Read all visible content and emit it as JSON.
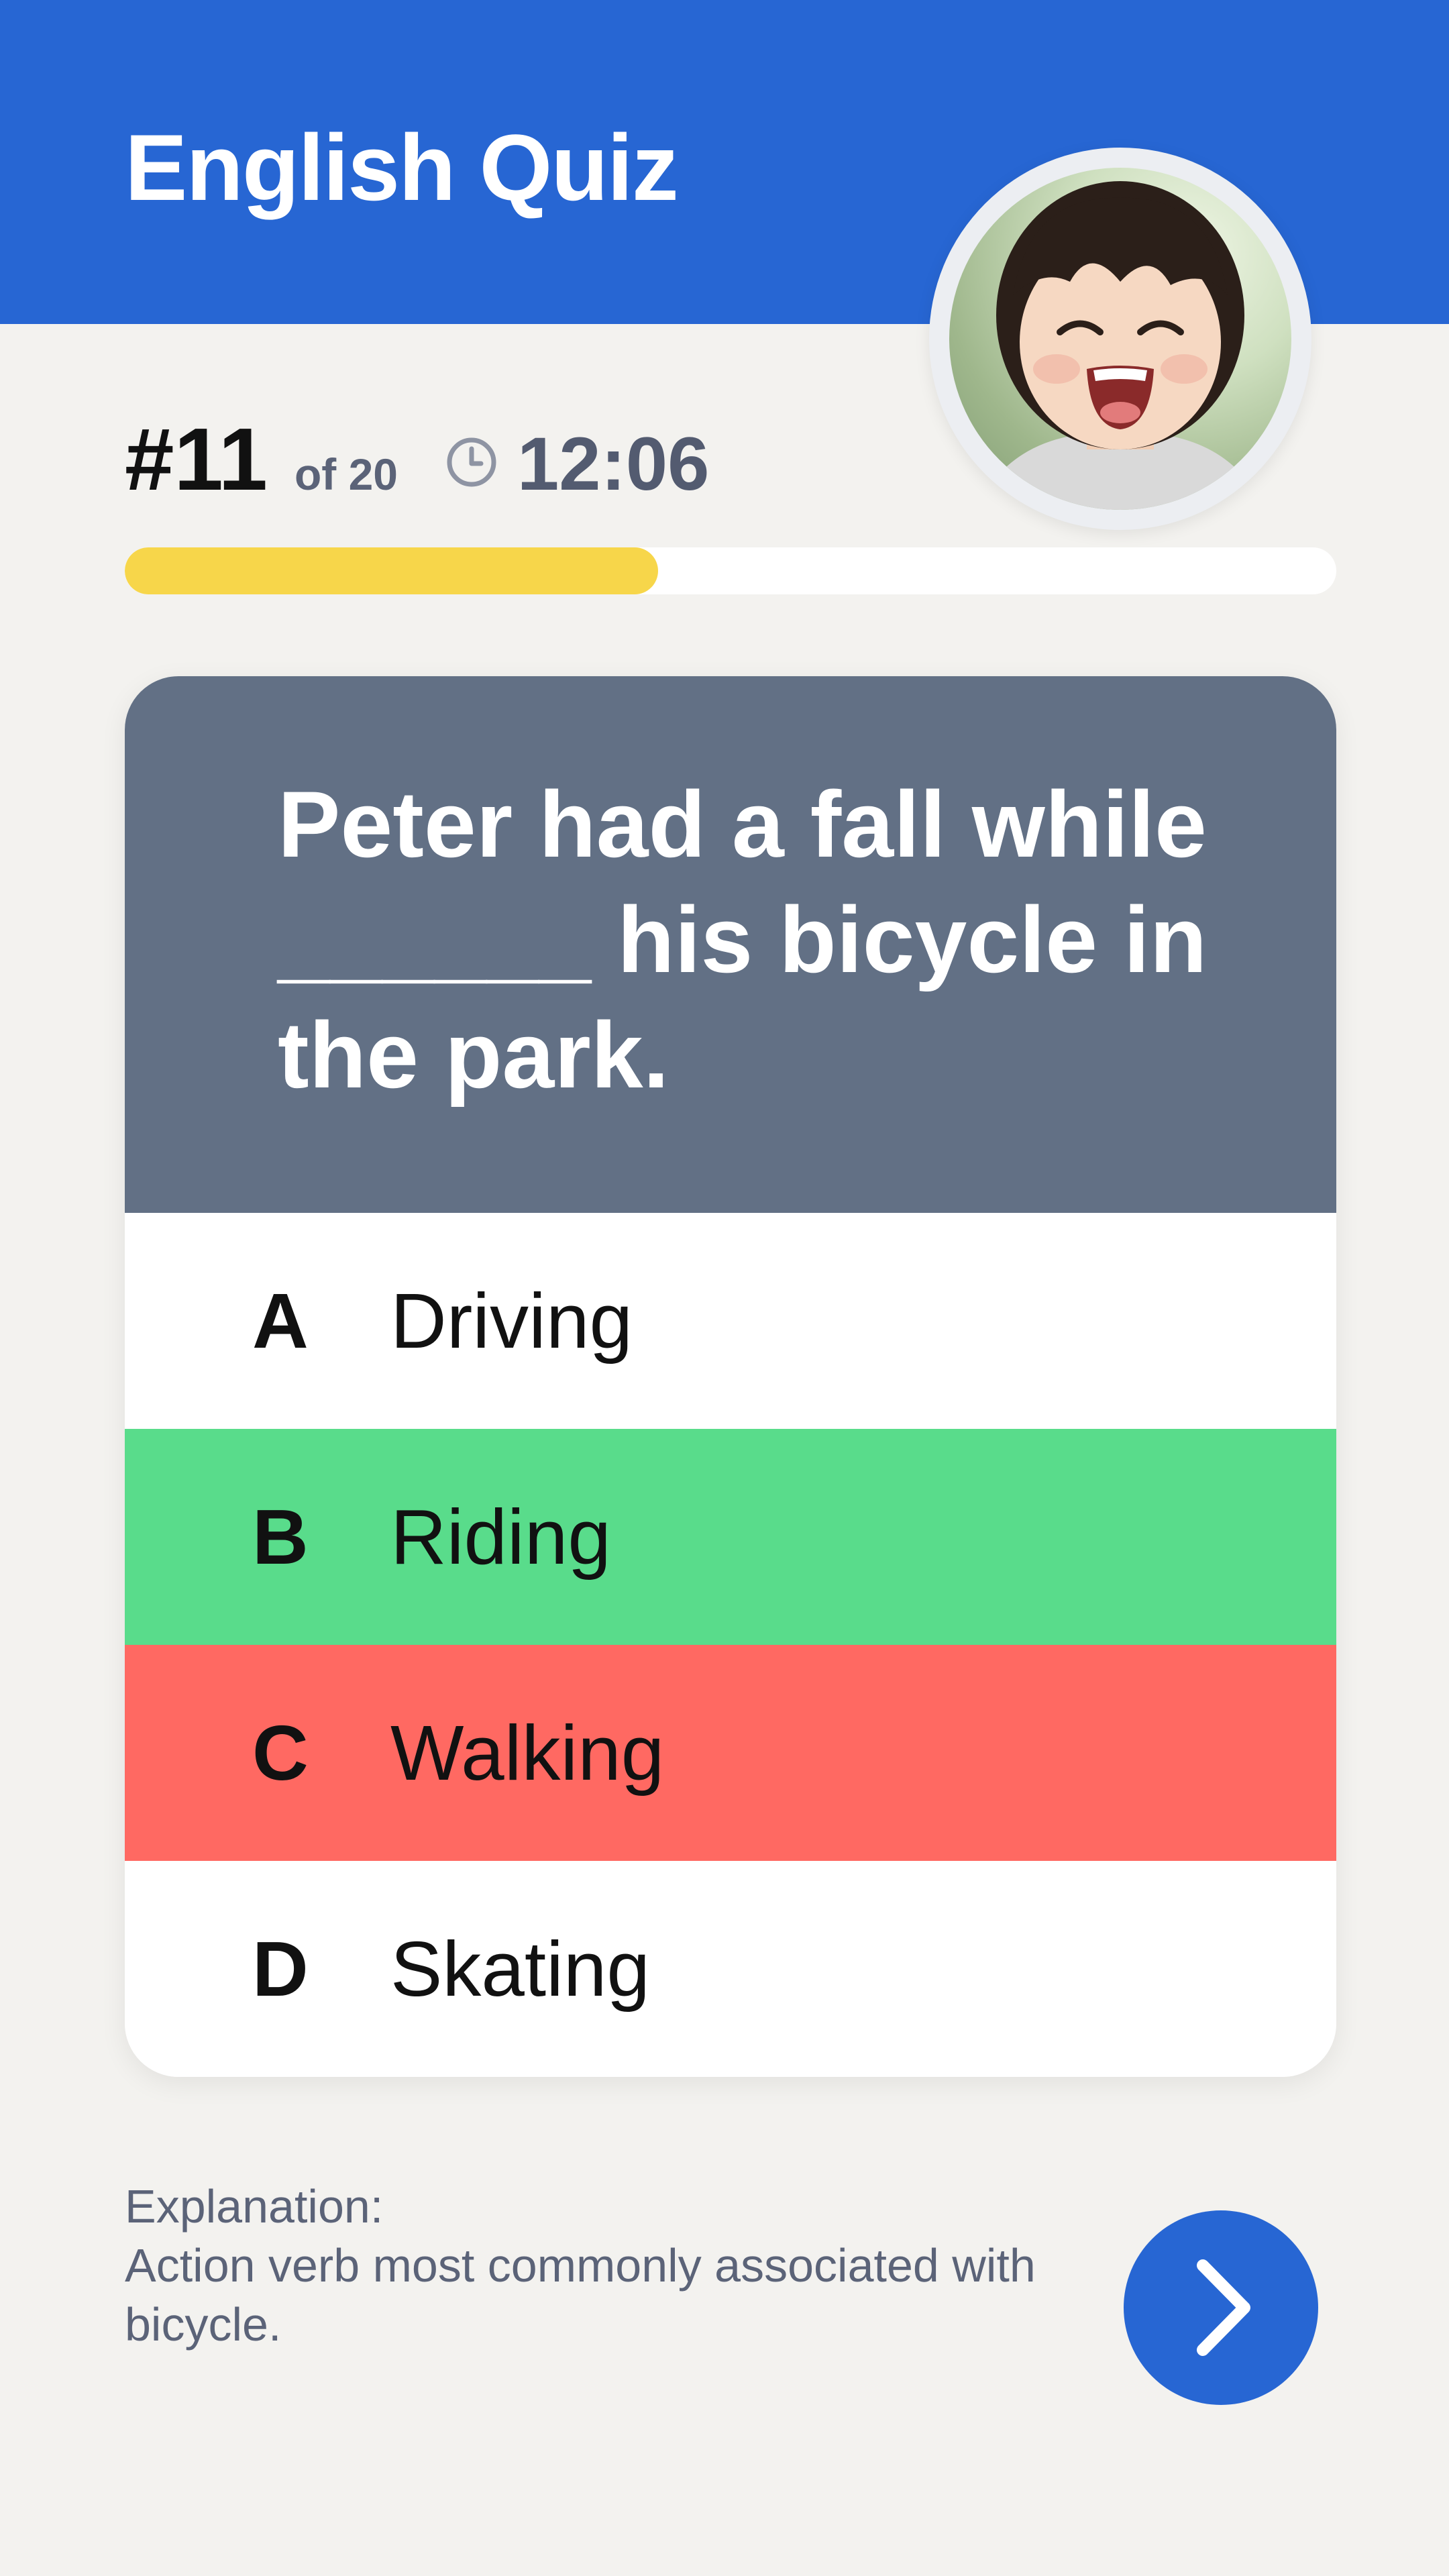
{
  "header": {
    "title": "English Quiz"
  },
  "stats": {
    "question_number": "#11",
    "question_total": "of 20",
    "timer": "12:06",
    "progress_fraction": 0.44
  },
  "question": {
    "text": "Peter had a fall while ______ his bicycle in the park."
  },
  "options": [
    {
      "letter": "A",
      "text": "Driving",
      "state": "default",
      "color": "#ffffff"
    },
    {
      "letter": "B",
      "text": "Riding",
      "state": "correct",
      "color": "#59dc8b"
    },
    {
      "letter": "C",
      "text": "Walking",
      "state": "incorrect",
      "color": "#ff6962"
    },
    {
      "letter": "D",
      "text": "Skating",
      "state": "default",
      "color": "#ffffff"
    }
  ],
  "explanation": {
    "label": "Explanation:",
    "text": "Action verb most commonly associated with bicycle."
  },
  "icons": {
    "timer": "clock-icon",
    "next": "chevron-right-icon"
  },
  "colors": {
    "brand_blue": "#2766d3",
    "progress": "#f7d64a",
    "question_bg": "#627085"
  }
}
